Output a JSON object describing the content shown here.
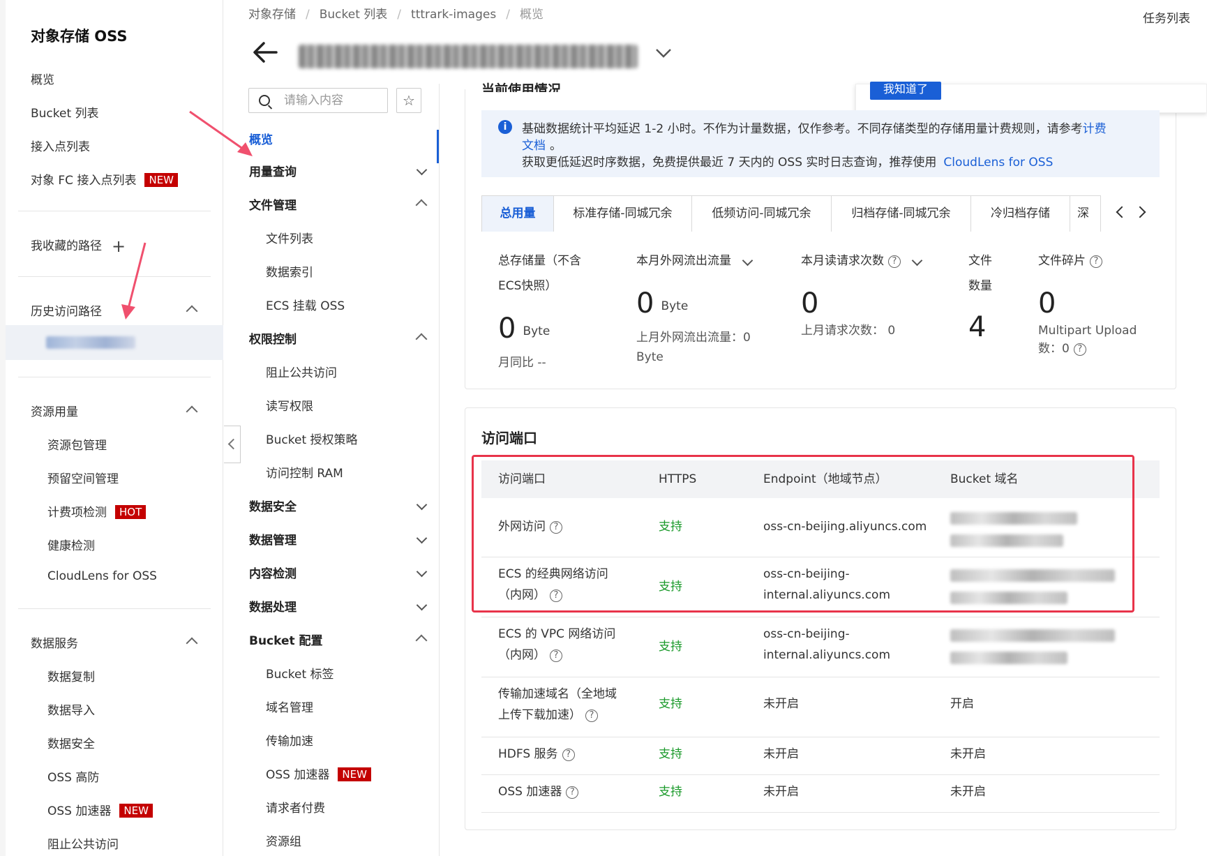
{
  "sidebar": {
    "title": "对象存储 OSS",
    "items": [
      "概览",
      "Bucket 列表",
      "接入点列表",
      "对象 FC 接入点列表"
    ],
    "fc_badge": "NEW",
    "favorites_label": "我收藏的路径",
    "history_label": "历史访问路径",
    "resource_label": "资源用量",
    "resource_items": [
      "资源包管理",
      "预留空间管理",
      "计费项检测",
      "健康检测",
      "CloudLens for OSS"
    ],
    "hot_badge": "HOT",
    "data_service_label": "数据服务",
    "data_service_items": [
      "数据复制",
      "数据导入",
      "数据安全",
      "OSS 高防",
      "OSS 加速器",
      "阻止公共访问"
    ],
    "new_badge": "NEW"
  },
  "header": {
    "breadcrumb": [
      "对象存储",
      "Bucket 列表",
      "tttrark-images",
      "概览"
    ],
    "task_list": "任务列表"
  },
  "subnav": {
    "search_placeholder": "请输入内容",
    "overview": "概览",
    "usage_query": "用量查询",
    "file_mgmt": "文件管理",
    "file_items": [
      "文件列表",
      "数据索引",
      "ECS 挂载 OSS"
    ],
    "permission": "权限控制",
    "permission_items": [
      "阻止公共访问",
      "读写权限",
      "Bucket 授权策略",
      "访问控制 RAM"
    ],
    "data_security": "数据安全",
    "data_mgmt": "数据管理",
    "content_check": "内容检测",
    "data_process": "数据处理",
    "bucket_config": "Bucket 配置",
    "config_items": [
      "Bucket 标签",
      "域名管理",
      "传输加速",
      "OSS 加速器",
      "请求者付费",
      "资源组"
    ],
    "new_badge": "NEW"
  },
  "usage": {
    "heading": "当前使用情况",
    "popup_button": "我知道了",
    "info_line1": "基础数据统计平均延迟 1-2 小时。不作为计量数据，仅作参考。不同存储类型的存储用量计费规则，请参考",
    "info_link1a": "计费",
    "info_link1b": "文档",
    "info_line2_end": "。",
    "info_line3": "获取更低延迟时序数据，免费提供最近 7 天内的 OSS 实时日志查询，推荐使用",
    "info_link2": "CloudLens for OSS",
    "tabs": [
      "总用量",
      "标准存储-同城冗余",
      "低频访问-同城冗余",
      "归档存储-同城冗余",
      "冷归档存储",
      "深"
    ],
    "stats": {
      "storage_label_1": "总存储量（不含",
      "storage_label_2": "ECS快照）",
      "storage_value": "0",
      "storage_unit": "Byte",
      "storage_mom": "月同比 --",
      "outbound_label": "本月外网流出流量",
      "outbound_value": "0",
      "outbound_unit": "Byte",
      "outbound_last_1": "上月外网流出流量：0",
      "outbound_last_2": "Byte",
      "requests_label": "本月读请求次数",
      "requests_value": "0",
      "requests_last": "上月请求次数：  0",
      "files_label_1": "文件",
      "files_label_2": "数量",
      "files_value": "4",
      "fragments_label": "文件碎片",
      "fragments_value": "0",
      "fragments_note_1": "Multipart Upload",
      "fragments_note_2": "数：0"
    }
  },
  "endpoints": {
    "title": "访问端口",
    "headers": [
      "访问端口",
      "HTTPS",
      "Endpoint（地域节点）",
      "Bucket 域名"
    ],
    "rows": [
      {
        "name_1": "外网访问",
        "name_2": "",
        "https": "支持",
        "endpoint_1": "oss-cn-beijing.aliyuncs.com",
        "endpoint_2": "",
        "domain": ""
      },
      {
        "name_1": "ECS 的经典网络访问",
        "name_2": "（内网）",
        "https": "支持",
        "endpoint_1": "oss-cn-beijing-",
        "endpoint_2": "internal.aliyuncs.com",
        "domain": ""
      },
      {
        "name_1": "ECS 的 VPC 网络访问",
        "name_2": "（内网）",
        "https": "支持",
        "endpoint_1": "oss-cn-beijing-",
        "endpoint_2": "internal.aliyuncs.com",
        "domain": ""
      },
      {
        "name_1": "传输加速域名（全地域",
        "name_2": "上传下载加速）",
        "https": "支持",
        "endpoint_1": "未开启",
        "endpoint_2": "",
        "domain": "开启"
      },
      {
        "name_1": "HDFS 服务",
        "name_2": "",
        "https": "支持",
        "endpoint_1": "未开启",
        "endpoint_2": "",
        "domain": "未开启"
      },
      {
        "name_1": "OSS 加速器",
        "name_2": "",
        "https": "支持",
        "endpoint_1": "未开启",
        "endpoint_2": "",
        "domain": "未开启"
      }
    ]
  },
  "colors": {
    "accent": "#1a5fd6",
    "green": "#1a9a2a",
    "badge_red": "#c40000",
    "highlight": "#e8334a",
    "arrow": "#f0506e"
  }
}
